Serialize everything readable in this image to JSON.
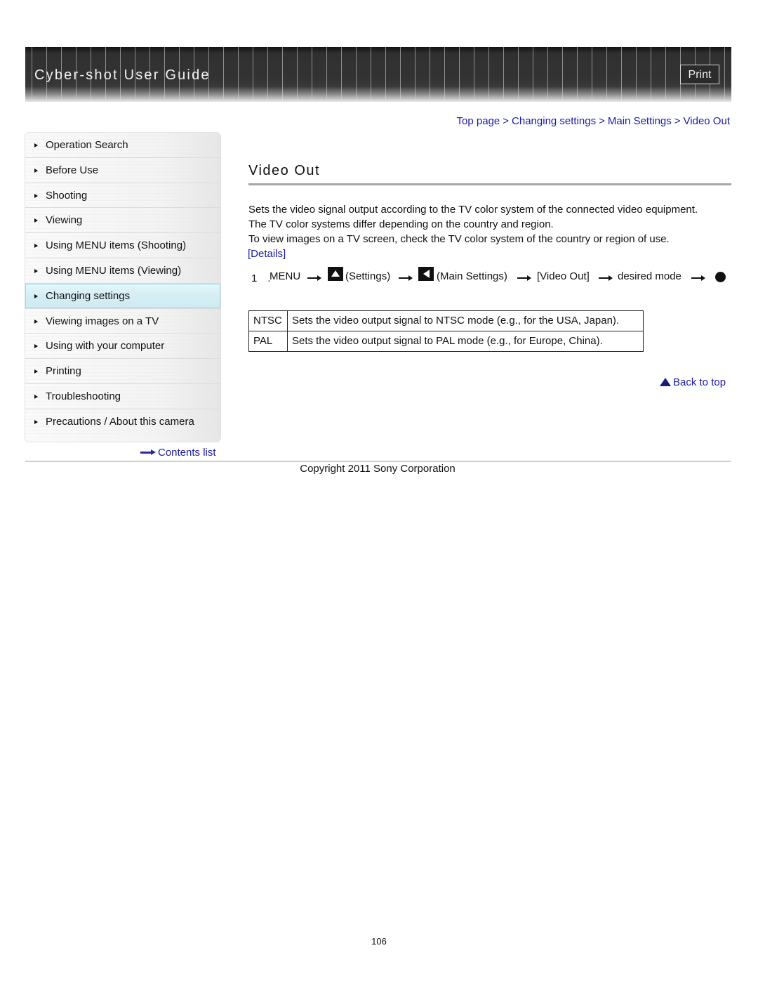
{
  "header": {
    "title": "Cyber-shot User Guide",
    "print_label": "Print"
  },
  "sidebar": {
    "items": [
      {
        "label": "Operation Search",
        "active": false
      },
      {
        "label": "Before Use",
        "active": false
      },
      {
        "label": "Shooting",
        "active": false
      },
      {
        "label": "Viewing",
        "active": false
      },
      {
        "label": "Using MENU items (Shooting)",
        "active": false
      },
      {
        "label": "Using MENU items (Viewing)",
        "active": false
      },
      {
        "label": "Changing settings",
        "active": true
      },
      {
        "label": "Viewing images on a TV",
        "active": false
      },
      {
        "label": "Using with your computer",
        "active": false
      },
      {
        "label": "Printing",
        "active": false
      },
      {
        "label": "Troubleshooting",
        "active": false
      },
      {
        "label": "Precautions / About this camera",
        "active": false
      }
    ],
    "contents_link": "Contents list"
  },
  "breadcrumb": {
    "items": [
      "Top page",
      "Changing settings",
      "Main Settings",
      "Video Out"
    ],
    "separator": ">"
  },
  "main": {
    "title": "Video Out",
    "paragraphs": [
      "Sets the video signal output according to the TV color system of the connected video equipment.",
      "The TV color systems differ depending on the country and region.",
      "To view images on a TV screen, check the TV color system of the country or region of use."
    ],
    "details_link": "[Details]",
    "step": {
      "number": "1　.",
      "menu": "MENU",
      "settings": "(Settings)",
      "main_settings": "(Main Settings)",
      "video_out": "[Video Out]",
      "desired_mode": "desired mode",
      "icons": [
        "settings-up-icon",
        "main-settings-left-icon",
        "center-button-icon"
      ]
    },
    "modes_table": {
      "rows": [
        {
          "mode": "NTSC",
          "description": "Sets the video output signal to NTSC mode (e.g., for the USA, Japan)."
        },
        {
          "mode": "PAL",
          "description": "Sets the video output signal to PAL mode (e.g., for Europe, China)."
        }
      ]
    },
    "back_to_top": "Back to top"
  },
  "footer": {
    "copyright": "Copyright 2011 Sony Corporation",
    "page_number": "106"
  },
  "colors": {
    "link": "#1a1aa6",
    "active_nav": "#d3eef4",
    "banner": "#333333"
  }
}
